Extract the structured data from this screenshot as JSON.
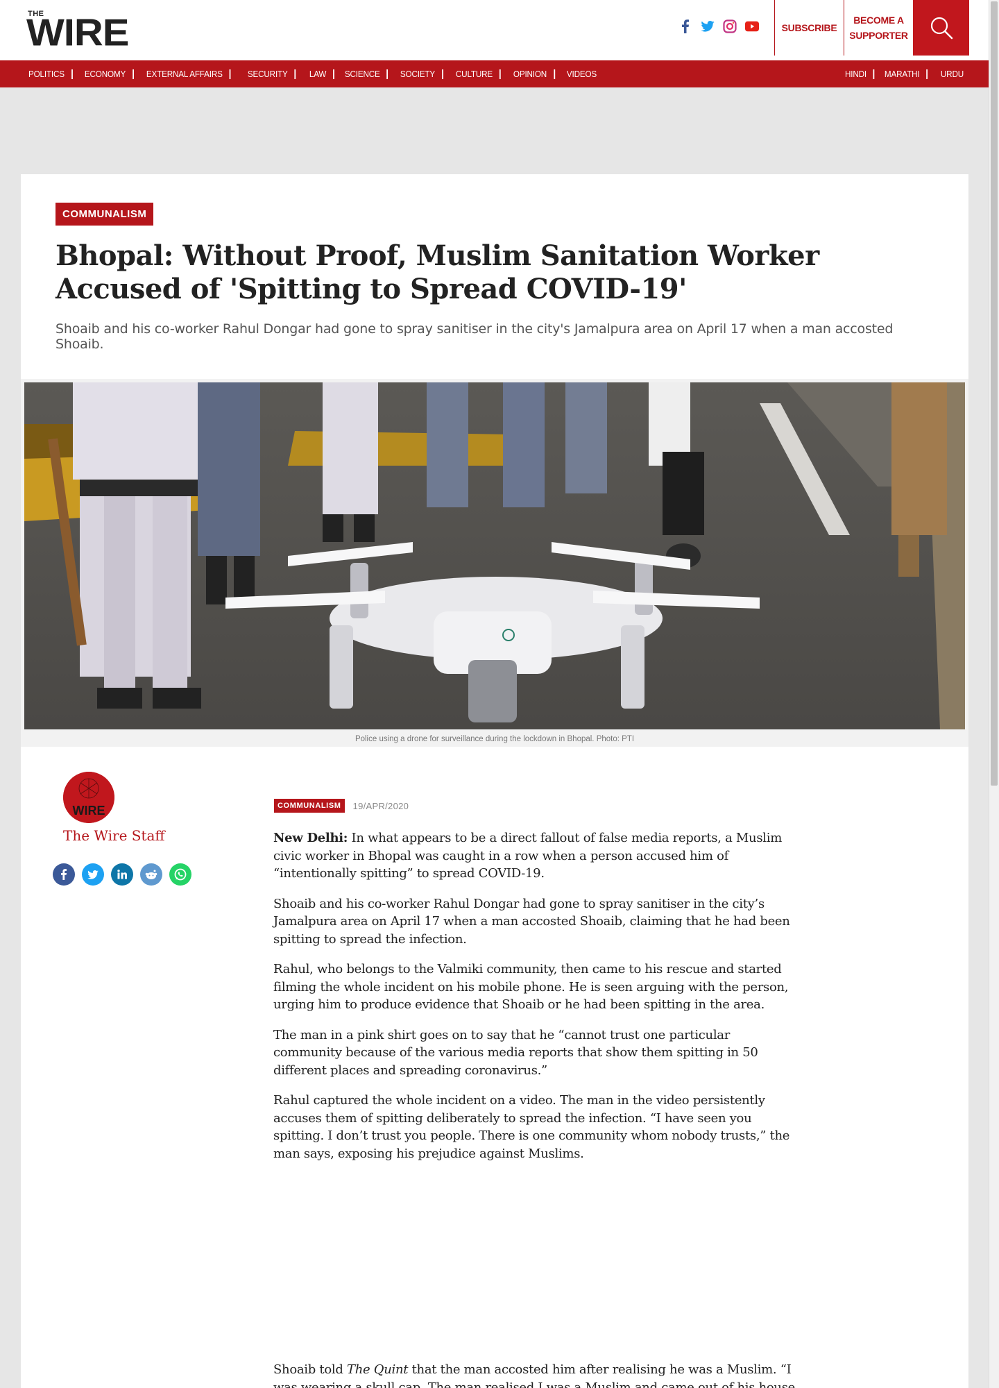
{
  "site": {
    "logo_small": "THE",
    "logo_big": "WIRE"
  },
  "header": {
    "social_icons": [
      "facebook-icon",
      "twitter-icon",
      "instagram-icon",
      "youtube-icon"
    ],
    "subscribe": "SUBSCRIBE",
    "supporter_line1": "BECOME A",
    "supporter_line2": "SUPPORTER",
    "search_icon": "search-icon"
  },
  "nav": {
    "left": [
      "POLITICS",
      "ECONOMY",
      "EXTERNAL AFFAIRS",
      "SECURITY",
      "LAW",
      "SCIENCE",
      "SOCIETY",
      "CULTURE",
      "OPINION",
      "VIDEOS"
    ],
    "right": [
      "HINDI",
      "MARATHI",
      "URDU"
    ]
  },
  "article": {
    "category": "COMMUNALISM",
    "headline": "Bhopal: Without Proof, Muslim Sanitation Worker Accused of 'Spitting to Spread COVID-19'",
    "dek": "Shoaib and his co-worker Rahul Dongar had gone to spray sanitiser in the city's Jamalpura area on April 17 when a man accosted Shoaib.",
    "caption": "Police using a drone for surveillance during the lockdown in Bhopal. Photo: PTI",
    "author": "The Wire Staff",
    "avatar_text": "WIRE",
    "share_icons": [
      "facebook-share-icon",
      "twitter-share-icon",
      "linkedin-share-icon",
      "reddit-share-icon",
      "whatsapp-share-icon"
    ],
    "meta_category": "COMMUNALISM",
    "date": "19/APR/2020",
    "dateline": "New Delhi:",
    "p1": " In what appears to be a direct fallout of false media reports, a Muslim civic worker in Bhopal was caught in a row when a person accused him of “intentionally spitting” to spread COVID-19.",
    "p2": "Shoaib and his co-worker Rahul Dongar had gone to spray sanitiser in the city’s Jamalpura area on April 17 when a man accosted Shoaib, claiming that he had been spitting to spread the infection.",
    "p3": "Rahul, who belongs to the Valmiki community, then came to his rescue and started filming the whole incident on his mobile phone. He is seen arguing with the person, urging him to produce evidence that Shoaib or he had been spitting in the area.",
    "p4": "The man in a pink shirt goes on to say that he “cannot trust one particular community because of the various media reports that show them spitting in 50 different places and spreading coronavirus.”",
    "p5": "Rahul captured the whole incident on a video. The man in the video persistently accuses them of spitting deliberately to spread the infection. “I have seen you spitting. I don’t trust you people. There is one community whom nobody trusts,” the man says, exposing his prejudice against Muslims.",
    "p6_a": "Shoaib ",
    "p6_link": "told ",
    "p6_link_em": "The Quint",
    "p6_b": " that the man accosted him after realising he was a Muslim. “I was wearing a skull cap. The man realised I was a Muslim and came out of his house. He held"
  },
  "colors": {
    "brand_red": "#b5161b",
    "text": "#222222"
  }
}
